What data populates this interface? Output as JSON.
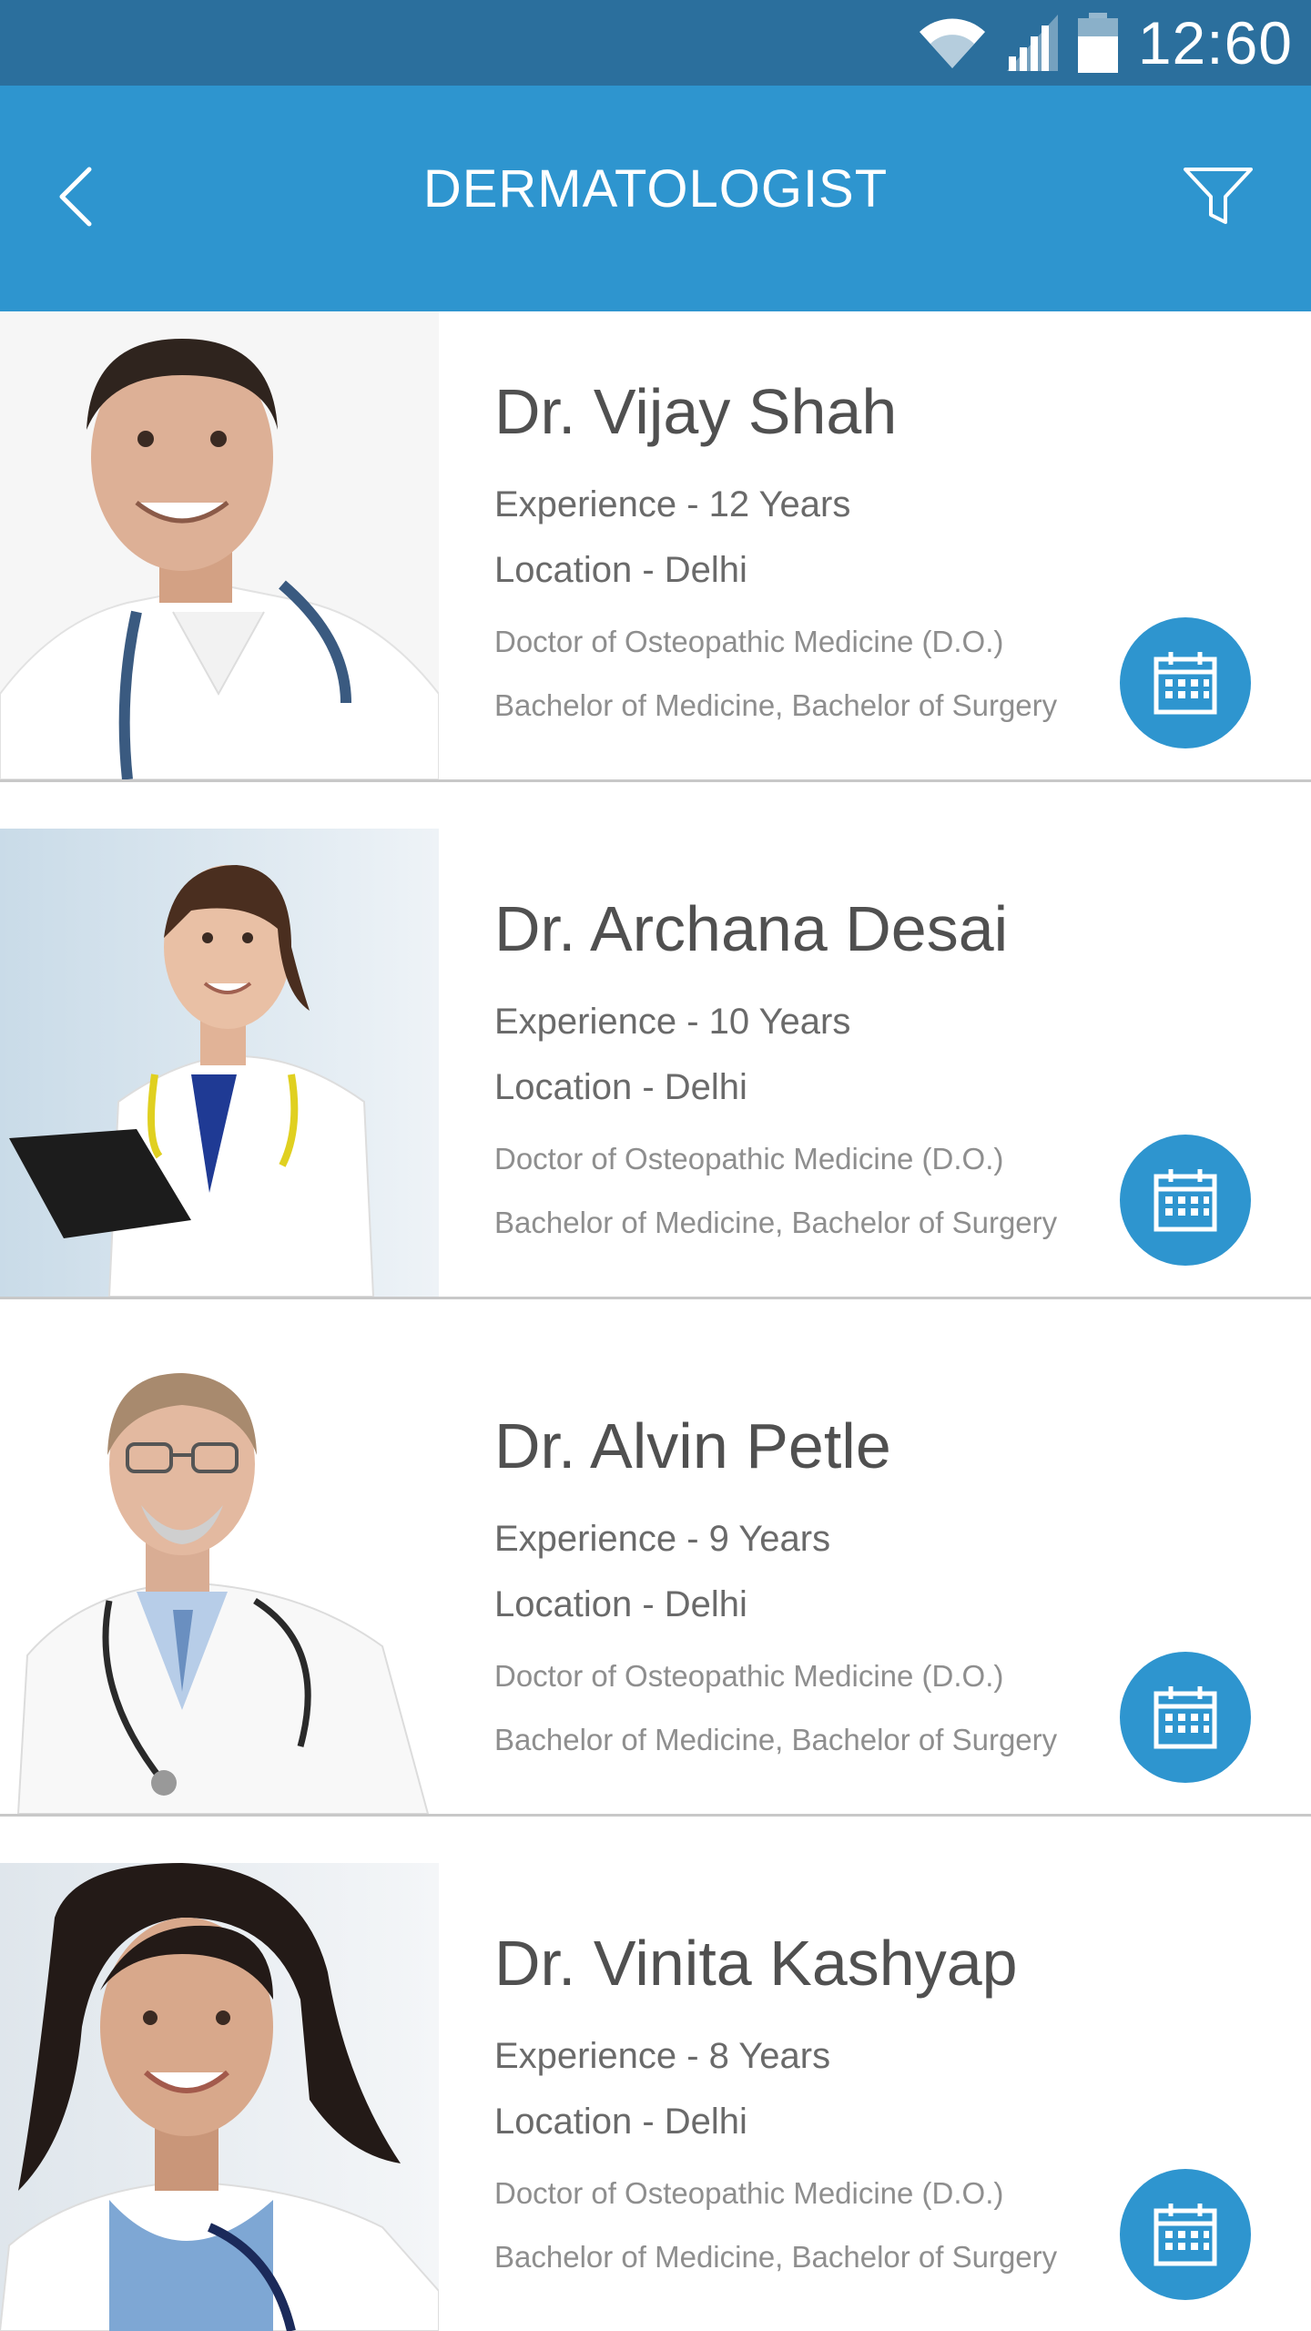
{
  "status_bar": {
    "time": "12:60",
    "icons": [
      "wifi-icon",
      "signal-icon",
      "battery-icon"
    ]
  },
  "app_bar": {
    "title": "DERMATOLOGIST",
    "back_icon": "chevron-left-icon",
    "filter_icon": "filter-icon"
  },
  "colors": {
    "status_bar": "#2b6f9d",
    "app_bar": "#2e95cf",
    "accent": "#2e95cf"
  },
  "doctors": [
    {
      "name": "Dr. Vijay Shah",
      "experience": "Experience - 12 Years",
      "location": "Location - Delhi",
      "degree_1": "Doctor of Osteopathic Medicine (D.O.)",
      "degree_2": "Bachelor of Medicine, Bachelor of Surgery",
      "action_icon": "calendar-icon"
    },
    {
      "name": "Dr. Archana Desai",
      "experience": "Experience - 10 Years",
      "location": "Location - Delhi",
      "degree_1": "Doctor of Osteopathic Medicine (D.O.)",
      "degree_2": "Bachelor of Medicine, Bachelor of Surgery",
      "action_icon": "calendar-icon"
    },
    {
      "name": "Dr. Alvin Petle",
      "experience": "Experience - 9 Years",
      "location": "Location - Delhi",
      "degree_1": "Doctor of Osteopathic Medicine (D.O.)",
      "degree_2": "Bachelor of Medicine, Bachelor of Surgery",
      "action_icon": "calendar-icon"
    },
    {
      "name": "Dr. Vinita Kashyap",
      "experience": "Experience - 8 Years",
      "location": "Location - Delhi",
      "degree_1": "Doctor of Osteopathic Medicine (D.O.)",
      "degree_2": "Bachelor of Medicine, Bachelor of Surgery",
      "action_icon": "calendar-icon"
    }
  ]
}
